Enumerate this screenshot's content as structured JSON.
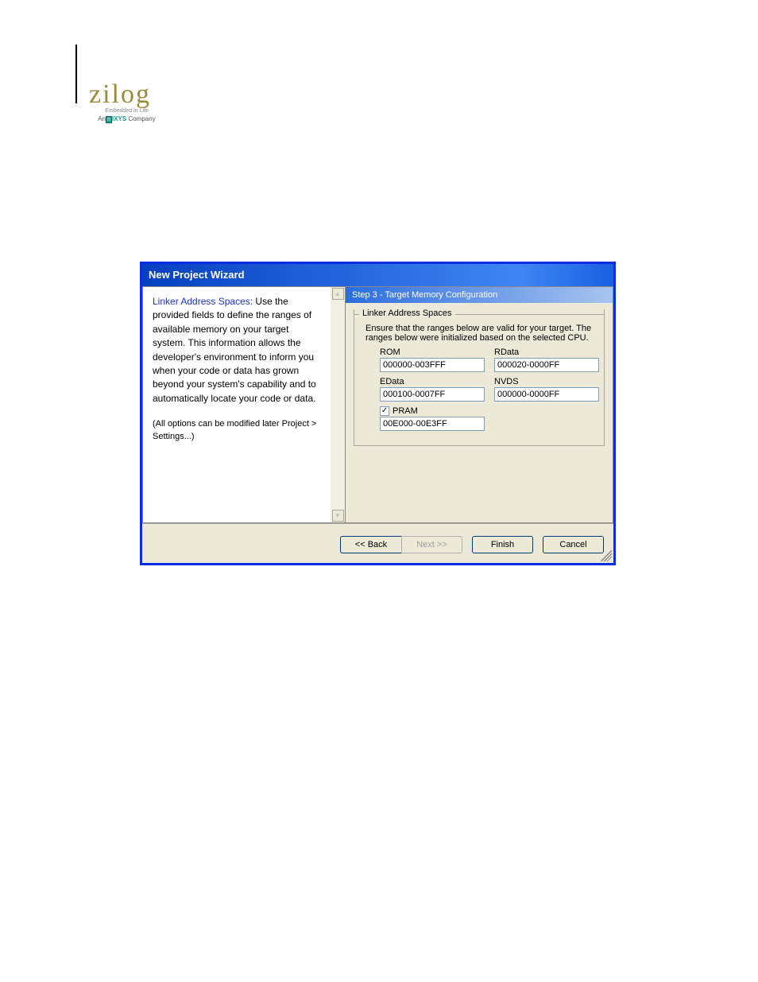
{
  "logo": {
    "brand": "zilog",
    "tagline": "Embedded in Life",
    "sub_prefix": "An",
    "sub_box": "n",
    "sub_brand": "IXYS",
    "sub_suffix": "Company"
  },
  "wizard": {
    "title": "New Project Wizard",
    "left": {
      "lead": "Linker Address Spaces:",
      "text": " Use the provided fields to define the ranges of available memory on your target system. This information allows the developer's environment to inform you when your code or data has grown beyond your system's capability and to automatically locate your code or data.",
      "footnote": "(All options can be modified later Project > Settings...)"
    },
    "step_header": "Step 3 - Target Memory Configuration",
    "group_legend": "Linker Address Spaces",
    "group_desc": "Ensure that the ranges below are valid for your target.  The ranges below were initialized based on the selected CPU.",
    "fields": {
      "rom": {
        "label": "ROM",
        "value": "000000-003FFF"
      },
      "rdata": {
        "label": "RData",
        "value": "000020-0000FF"
      },
      "edata": {
        "label": "EData",
        "value": "000100-0007FF"
      },
      "nvds": {
        "label": "NVDS",
        "value": "000000-0000FF"
      },
      "pram": {
        "label": "PRAM",
        "checked": true,
        "value": "00E000-00E3FF"
      }
    },
    "buttons": {
      "back": "<< Back",
      "next": "Next >>",
      "finish": "Finish",
      "cancel": "Cancel"
    }
  }
}
